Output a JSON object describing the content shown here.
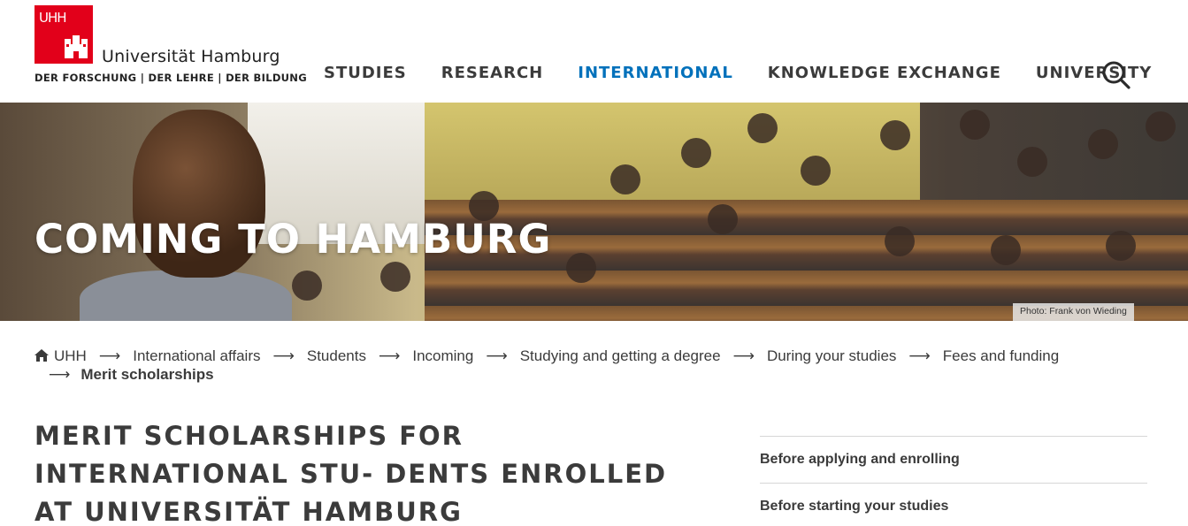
{
  "logo": {
    "badge_text": "UHH",
    "name": "Universität Hamburg",
    "tagline": "DER FORSCHUNG | DER LEHRE | DER BILDUNG",
    "brand_color": "#e2001a"
  },
  "nav": {
    "items": [
      {
        "label": "STUDIES"
      },
      {
        "label": "RESEARCH"
      },
      {
        "label": "INTERNATIONAL",
        "active": true
      },
      {
        "label": "KNOWLEDGE EXCHANGE"
      },
      {
        "label": "UNIVERSITY"
      }
    ],
    "search_icon": "search-icon",
    "active_color": "#0271bb"
  },
  "hero": {
    "title": "COMING TO HAMBURG",
    "photo_credit": "Photo: Frank von Wieding"
  },
  "breadcrumb": {
    "home_icon": "home-icon",
    "items": [
      "UHH",
      "International affairs",
      "Students",
      "Incoming",
      "Studying and getting a degree",
      "During your studies",
      "Fees and funding"
    ],
    "current": "Merit scholarships",
    "separator": "⟶"
  },
  "page": {
    "title": "MERIT SCHOLARSHIPS FOR INTERNATIONAL STU- DENTS ENROLLED AT UNIVERSITÄT HAMBURG"
  },
  "sidenav": {
    "items": [
      "Before applying and enrolling",
      "Before starting your studies"
    ]
  }
}
